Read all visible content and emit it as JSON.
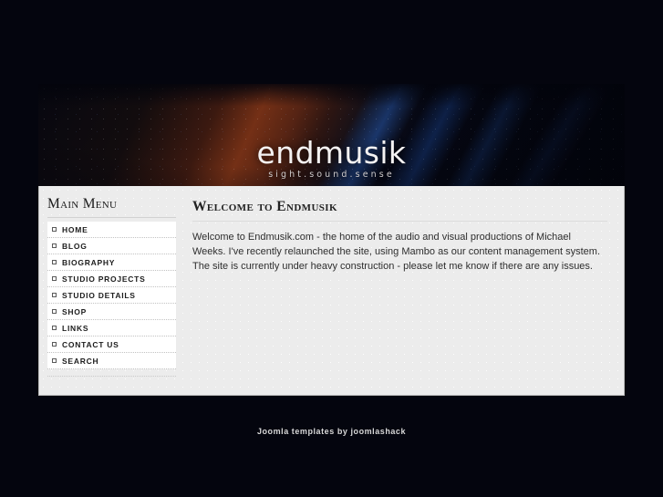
{
  "site": {
    "logo_word": "endmusik",
    "logo_tagline": "sight.sound.sense"
  },
  "sidebar": {
    "heading": "Main Menu",
    "items": [
      {
        "label": "Home",
        "bullet": "square-bullet-icon"
      },
      {
        "label": "Blog",
        "bullet": "square-bullet-icon"
      },
      {
        "label": "Biography",
        "bullet": "square-bullet-icon"
      },
      {
        "label": "Studio Projects",
        "bullet": "square-bullet-icon"
      },
      {
        "label": "Studio Details",
        "bullet": "square-bullet-icon"
      },
      {
        "label": "Shop",
        "bullet": "square-bullet-icon"
      },
      {
        "label": "Links",
        "bullet": "square-bullet-icon"
      },
      {
        "label": "Contact Us",
        "bullet": "square-bullet-icon"
      },
      {
        "label": "Search",
        "bullet": "square-bullet-icon"
      }
    ]
  },
  "content": {
    "heading": "Welcome to Endmusik",
    "body": "Welcome to Endmusik.com - the home of the audio and visual productions of Michael Weeks. I've recently relaunched the site, using Mambo as our content management system. The site is currently under heavy construction - please let me know if there are any issues."
  },
  "footer": {
    "credit": "Joomla templates by joomlashack"
  },
  "colors": {
    "page_background": "#04050e",
    "panel_background": "#ececec",
    "menu_item_background": "#ffffff",
    "banner_warm_accent": "#7a3216",
    "banner_cool_accent": "#2860be",
    "text_primary": "#1c1c1c",
    "footer_text": "#d8d8d8"
  }
}
